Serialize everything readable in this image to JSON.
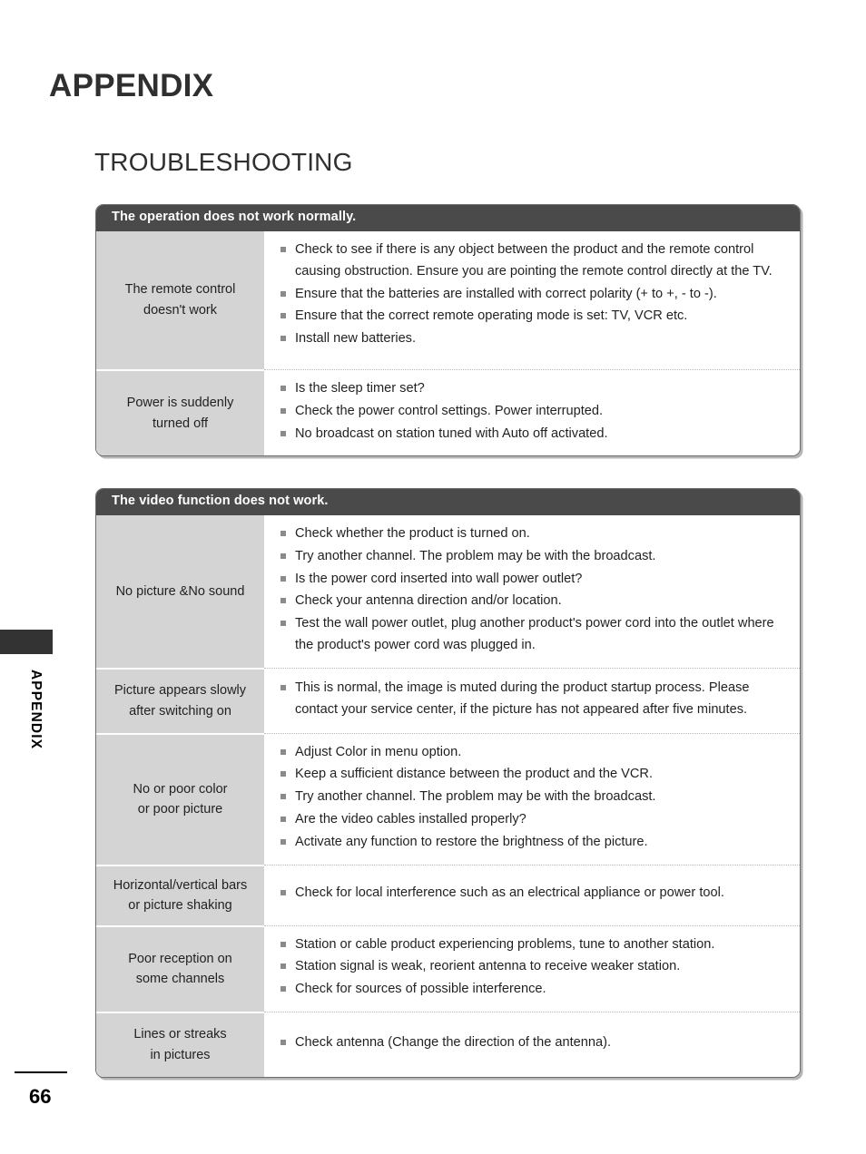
{
  "page": {
    "title": "APPENDIX",
    "section_title": "TROUBLESHOOTING",
    "side_label": "APPENDIX",
    "page_number": "66"
  },
  "colors": {
    "header_bar": "#4a4a4a",
    "label_cell": "#d4d4d4",
    "bullet": "#8a8a8a",
    "text": "#231f20",
    "edge_tab": "#333333"
  },
  "tables": [
    {
      "header": "The operation does not work normally.",
      "rows": [
        {
          "label_lines": [
            "The remote control",
            "doesn't work"
          ],
          "items": [
            "Check to see if there is any object between the product and the remote control causing obstruction. Ensure you are pointing the remote control directly at the TV.",
            "Ensure that the batteries are installed with correct polarity (+ to +, - to -).",
            "Ensure that the correct remote operating mode is set: TV, VCR etc.",
            "Install new batteries."
          ]
        },
        {
          "label_lines": [
            "Power is suddenly",
            "turned off"
          ],
          "items": [
            "Is the sleep timer set?",
            "Check the power control settings. Power interrupted.",
            "No broadcast on station tuned with Auto off activated."
          ]
        }
      ]
    },
    {
      "header": "The video function does not work.",
      "rows": [
        {
          "label_lines": [
            "No picture &No sound"
          ],
          "items": [
            "Check whether the product is turned on.",
            "Try another channel. The problem may be with the broadcast.",
            "Is the power cord inserted into wall power outlet?",
            "Check your antenna direction and/or location.",
            "Test the wall power outlet, plug another product's power cord into the outlet where the product's power cord was plugged in."
          ]
        },
        {
          "label_lines": [
            "Picture appears slowly",
            "after switching on"
          ],
          "items": [
            "This is normal, the image is muted during the product startup process. Please contact your service center, if the picture has not appeared after five minutes."
          ]
        },
        {
          "label_lines": [
            "No or poor color",
            "or poor picture"
          ],
          "items": [
            "Adjust Color in menu option.",
            "Keep a sufficient distance between the product and the VCR.",
            "Try another channel. The problem may be with the broadcast.",
            "Are the video cables installed properly?",
            "Activate any function to restore the brightness of the picture."
          ]
        },
        {
          "label_lines": [
            "Horizontal/vertical bars",
            "or picture shaking"
          ],
          "items": [
            "Check for local interference such as an electrical appliance or power tool."
          ]
        },
        {
          "label_lines": [
            "Poor reception on",
            "some channels"
          ],
          "items": [
            "Station or cable product experiencing problems, tune to another station.",
            "Station signal is weak, reorient antenna to receive weaker station.",
            "Check for sources of possible interference."
          ]
        },
        {
          "label_lines": [
            "Lines or streaks",
            "in pictures"
          ],
          "items": [
            "Check antenna (Change the direction of the antenna)."
          ]
        }
      ]
    }
  ]
}
